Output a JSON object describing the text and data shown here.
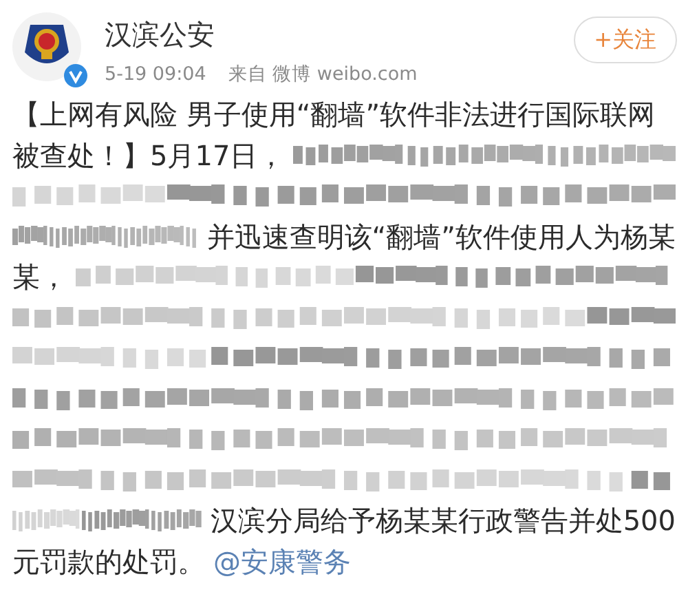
{
  "account": {
    "name": "汉滨公安",
    "verified": true,
    "time": "5-19 09:04",
    "source": "来自 微博 weibo.com"
  },
  "follow_button": {
    "label": "+关注"
  },
  "post": {
    "lines": [
      [
        {
          "kind": "text",
          "text": "【上网有风险 男子使用“翻墙”软件非法进行国际联网"
        }
      ],
      [
        {
          "kind": "text",
          "text": "被查处！】5月17日，"
        },
        {
          "kind": "blur"
        }
      ],
      [
        {
          "kind": "blur"
        }
      ],
      [
        {
          "kind": "blur"
        },
        {
          "kind": "text",
          "text": "并迅速查明该“翻墙”软件使用人为杨某"
        }
      ],
      [
        {
          "kind": "text",
          "text": "某，"
        },
        {
          "kind": "blur"
        }
      ],
      [
        {
          "kind": "blur"
        }
      ],
      [
        {
          "kind": "blur"
        }
      ],
      [
        {
          "kind": "blur"
        }
      ],
      [
        {
          "kind": "blur"
        }
      ],
      [
        {
          "kind": "blur"
        }
      ],
      [
        {
          "kind": "blur"
        },
        {
          "kind": "text",
          "text": "汉滨分局给予杨某某行政警告并处500"
        }
      ],
      [
        {
          "kind": "text",
          "text": "元罚款的处罚。"
        },
        {
          "kind": "mention",
          "text": "@安康警务"
        }
      ]
    ]
  }
}
